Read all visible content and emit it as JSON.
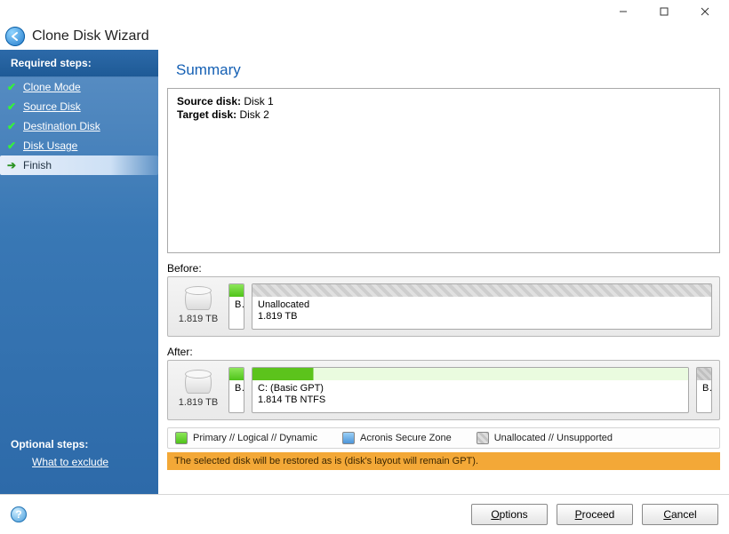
{
  "window": {
    "title": "Clone Disk Wizard"
  },
  "sidebar": {
    "required_header": "Required steps:",
    "items": [
      {
        "label": "Clone Mode",
        "done": true
      },
      {
        "label": "Source Disk",
        "done": true
      },
      {
        "label": "Destination Disk",
        "done": true
      },
      {
        "label": "Disk Usage",
        "done": true
      },
      {
        "label": "Finish",
        "done": false,
        "active": true
      }
    ],
    "optional_header": "Optional steps:",
    "optional_link": "What to exclude"
  },
  "summary": {
    "heading": "Summary",
    "source_label": "Source disk:",
    "source_value": "Disk 1",
    "target_label": "Target disk:",
    "target_value": "Disk 2"
  },
  "before": {
    "label": "Before:",
    "disk_size": "1.819 TB",
    "p0_label": "B...",
    "p1_name": "Unallocated",
    "p1_size": "1.819 TB"
  },
  "after": {
    "label": "After:",
    "disk_size": "1.819 TB",
    "p0_label": "B...",
    "p1_name": "C: (Basic GPT)",
    "p1_size": "1.814 TB  NTFS",
    "p2_label": "B..."
  },
  "legend": {
    "primary": "Primary // Logical // Dynamic",
    "zone": "Acronis Secure Zone",
    "unalloc": "Unallocated // Unsupported"
  },
  "warning": "The selected disk will be restored as is (disk's layout will remain GPT).",
  "footer": {
    "options": "Options",
    "proceed": "Proceed",
    "cancel": "Cancel"
  }
}
